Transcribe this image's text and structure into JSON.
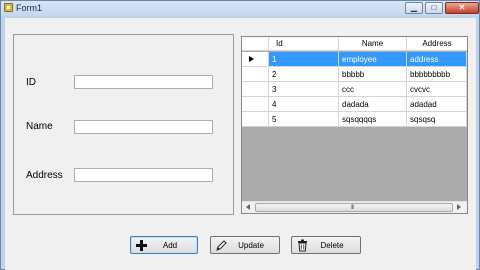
{
  "window": {
    "title": "Form1",
    "min_glyph": "▁",
    "max_glyph": "□",
    "close_glyph": "✕"
  },
  "form": {
    "id_label": "ID",
    "name_label": "Name",
    "address_label": "Address",
    "id_value": "",
    "name_value": "",
    "address_value": ""
  },
  "grid": {
    "columns": [
      "Id",
      "Name",
      "Address"
    ],
    "rows": [
      {
        "id": "1",
        "name": "employee",
        "address": "address"
      },
      {
        "id": "2",
        "name": "bbbbb",
        "address": "bbbbbbbbb"
      },
      {
        "id": "3",
        "name": "ccc",
        "address": "cvcvc"
      },
      {
        "id": "4",
        "name": "dadada",
        "address": "adadad"
      },
      {
        "id": "5",
        "name": "sqsqqqqs",
        "address": "sqsqsq"
      }
    ],
    "selected_row": 0,
    "scroll_grip": "III"
  },
  "buttons": {
    "add_label": "Add",
    "update_label": "Update",
    "delete_label": "Delete"
  },
  "colors": {
    "selection": "#3399ff",
    "grid_background": "#ababab"
  },
  "icons": {
    "add": "plus-icon",
    "update": "pencil-icon",
    "delete": "trash-icon"
  }
}
